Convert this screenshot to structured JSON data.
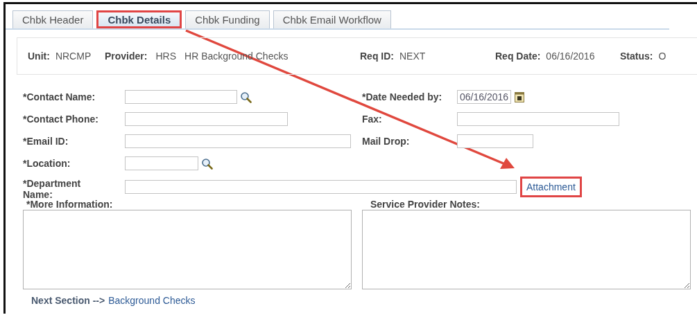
{
  "tabs": [
    {
      "label": "Chbk Header",
      "selected": false,
      "highlighted": false
    },
    {
      "label": "Chbk Details",
      "selected": true,
      "highlighted": true
    },
    {
      "label": "Chbk Funding",
      "selected": false,
      "highlighted": false
    },
    {
      "label": "Chbk Email Workflow",
      "selected": false,
      "highlighted": false
    }
  ],
  "header": [
    {
      "label": "Unit:",
      "values": [
        "NRCMP"
      ]
    },
    {
      "label": "Provider:",
      "values": [
        "HRS",
        "HR Background Checks"
      ]
    },
    {
      "label": "Req ID:",
      "values": [
        "NEXT"
      ]
    },
    {
      "label": "Req Date:",
      "values": [
        "06/16/2016"
      ]
    },
    {
      "label": "Status:",
      "values": [
        "O"
      ]
    }
  ],
  "rows": [
    {
      "left": {
        "label": "*Contact Name:",
        "kind": "lookup"
      },
      "right": {
        "label": "*Date Needed by:",
        "kind": "date",
        "value": "06/16/2016"
      }
    },
    {
      "left": {
        "label": "*Contact Phone:",
        "kind": "text"
      },
      "right": {
        "label": "Fax:",
        "kind": "text"
      }
    },
    {
      "left": {
        "label": "*Email ID:",
        "kind": "text"
      },
      "right": {
        "label": "Mail Drop:",
        "kind": "text"
      }
    },
    {
      "left": {
        "label": "*Location:",
        "kind": "lookup"
      }
    },
    {
      "left": {
        "label": "*Department Name:",
        "kind": "text"
      },
      "link": {
        "label": "Attachment",
        "highlighted": true
      }
    }
  ],
  "notes": [
    {
      "label": "*More Information:"
    },
    {
      "label": "Service Provider Notes:"
    }
  ],
  "footer": {
    "label": "Next Section -->",
    "link": "Background Checks"
  }
}
